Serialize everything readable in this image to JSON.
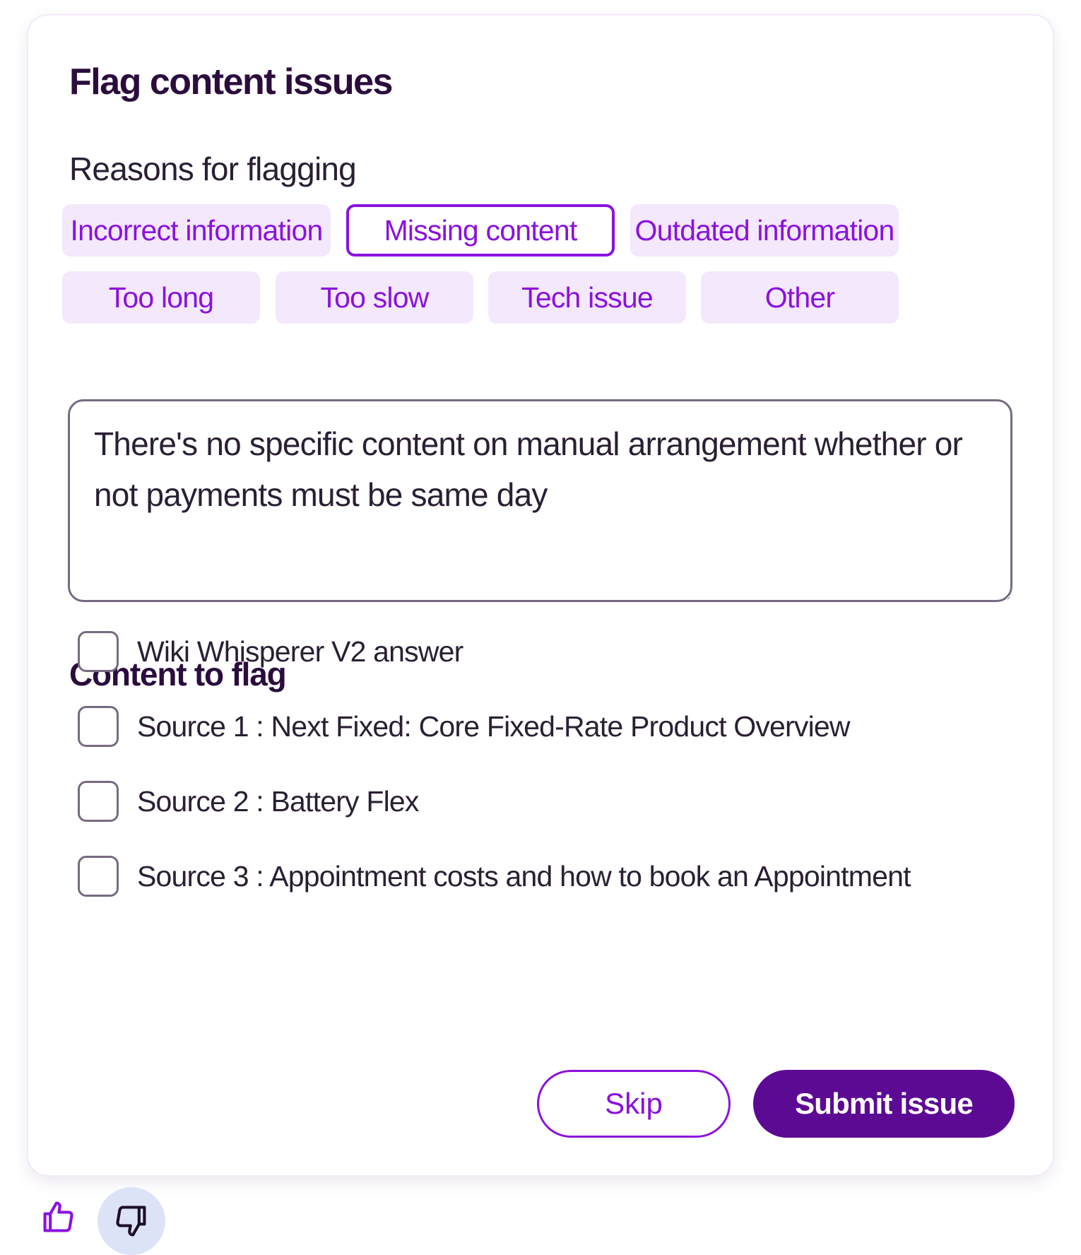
{
  "panel": {
    "title": "Flag content issues",
    "reasons_label": "Reasons for flagging"
  },
  "reasons": [
    {
      "label": "Incorrect information",
      "selected": false
    },
    {
      "label": "Missing content",
      "selected": true
    },
    {
      "label": "Outdated information",
      "selected": false
    },
    {
      "label": "Too long",
      "selected": false
    },
    {
      "label": "Too slow",
      "selected": false
    },
    {
      "label": "Tech issue",
      "selected": false
    },
    {
      "label": "Other",
      "selected": false
    }
  ],
  "comment": {
    "value": "There's no specific content on manual arrangement whether or not payments must be same day"
  },
  "content_to_flag": {
    "title": "Content to flag",
    "items": [
      {
        "label": "Wiki Whisperer V2 answer",
        "checked": false
      },
      {
        "label": "Source 1 : Next Fixed: Core Fixed-Rate Product Overview",
        "checked": false
      },
      {
        "label": "Source 2 : Battery Flex",
        "checked": false
      },
      {
        "label": "Source 3 : Appointment costs and how to book an Appointment",
        "checked": false
      }
    ]
  },
  "actions": {
    "skip_label": "Skip",
    "submit_label": "Submit issue"
  },
  "feedback": {
    "thumbs_up_icon": "thumbs-up-icon",
    "thumbs_down_icon": "thumbs-down-icon",
    "thumbs_down_active": true
  },
  "colors": {
    "accent": "#8a12de",
    "primary_button": "#5c0a94",
    "chip_background": "#f4e8fc",
    "heading": "#2a0d3d"
  }
}
